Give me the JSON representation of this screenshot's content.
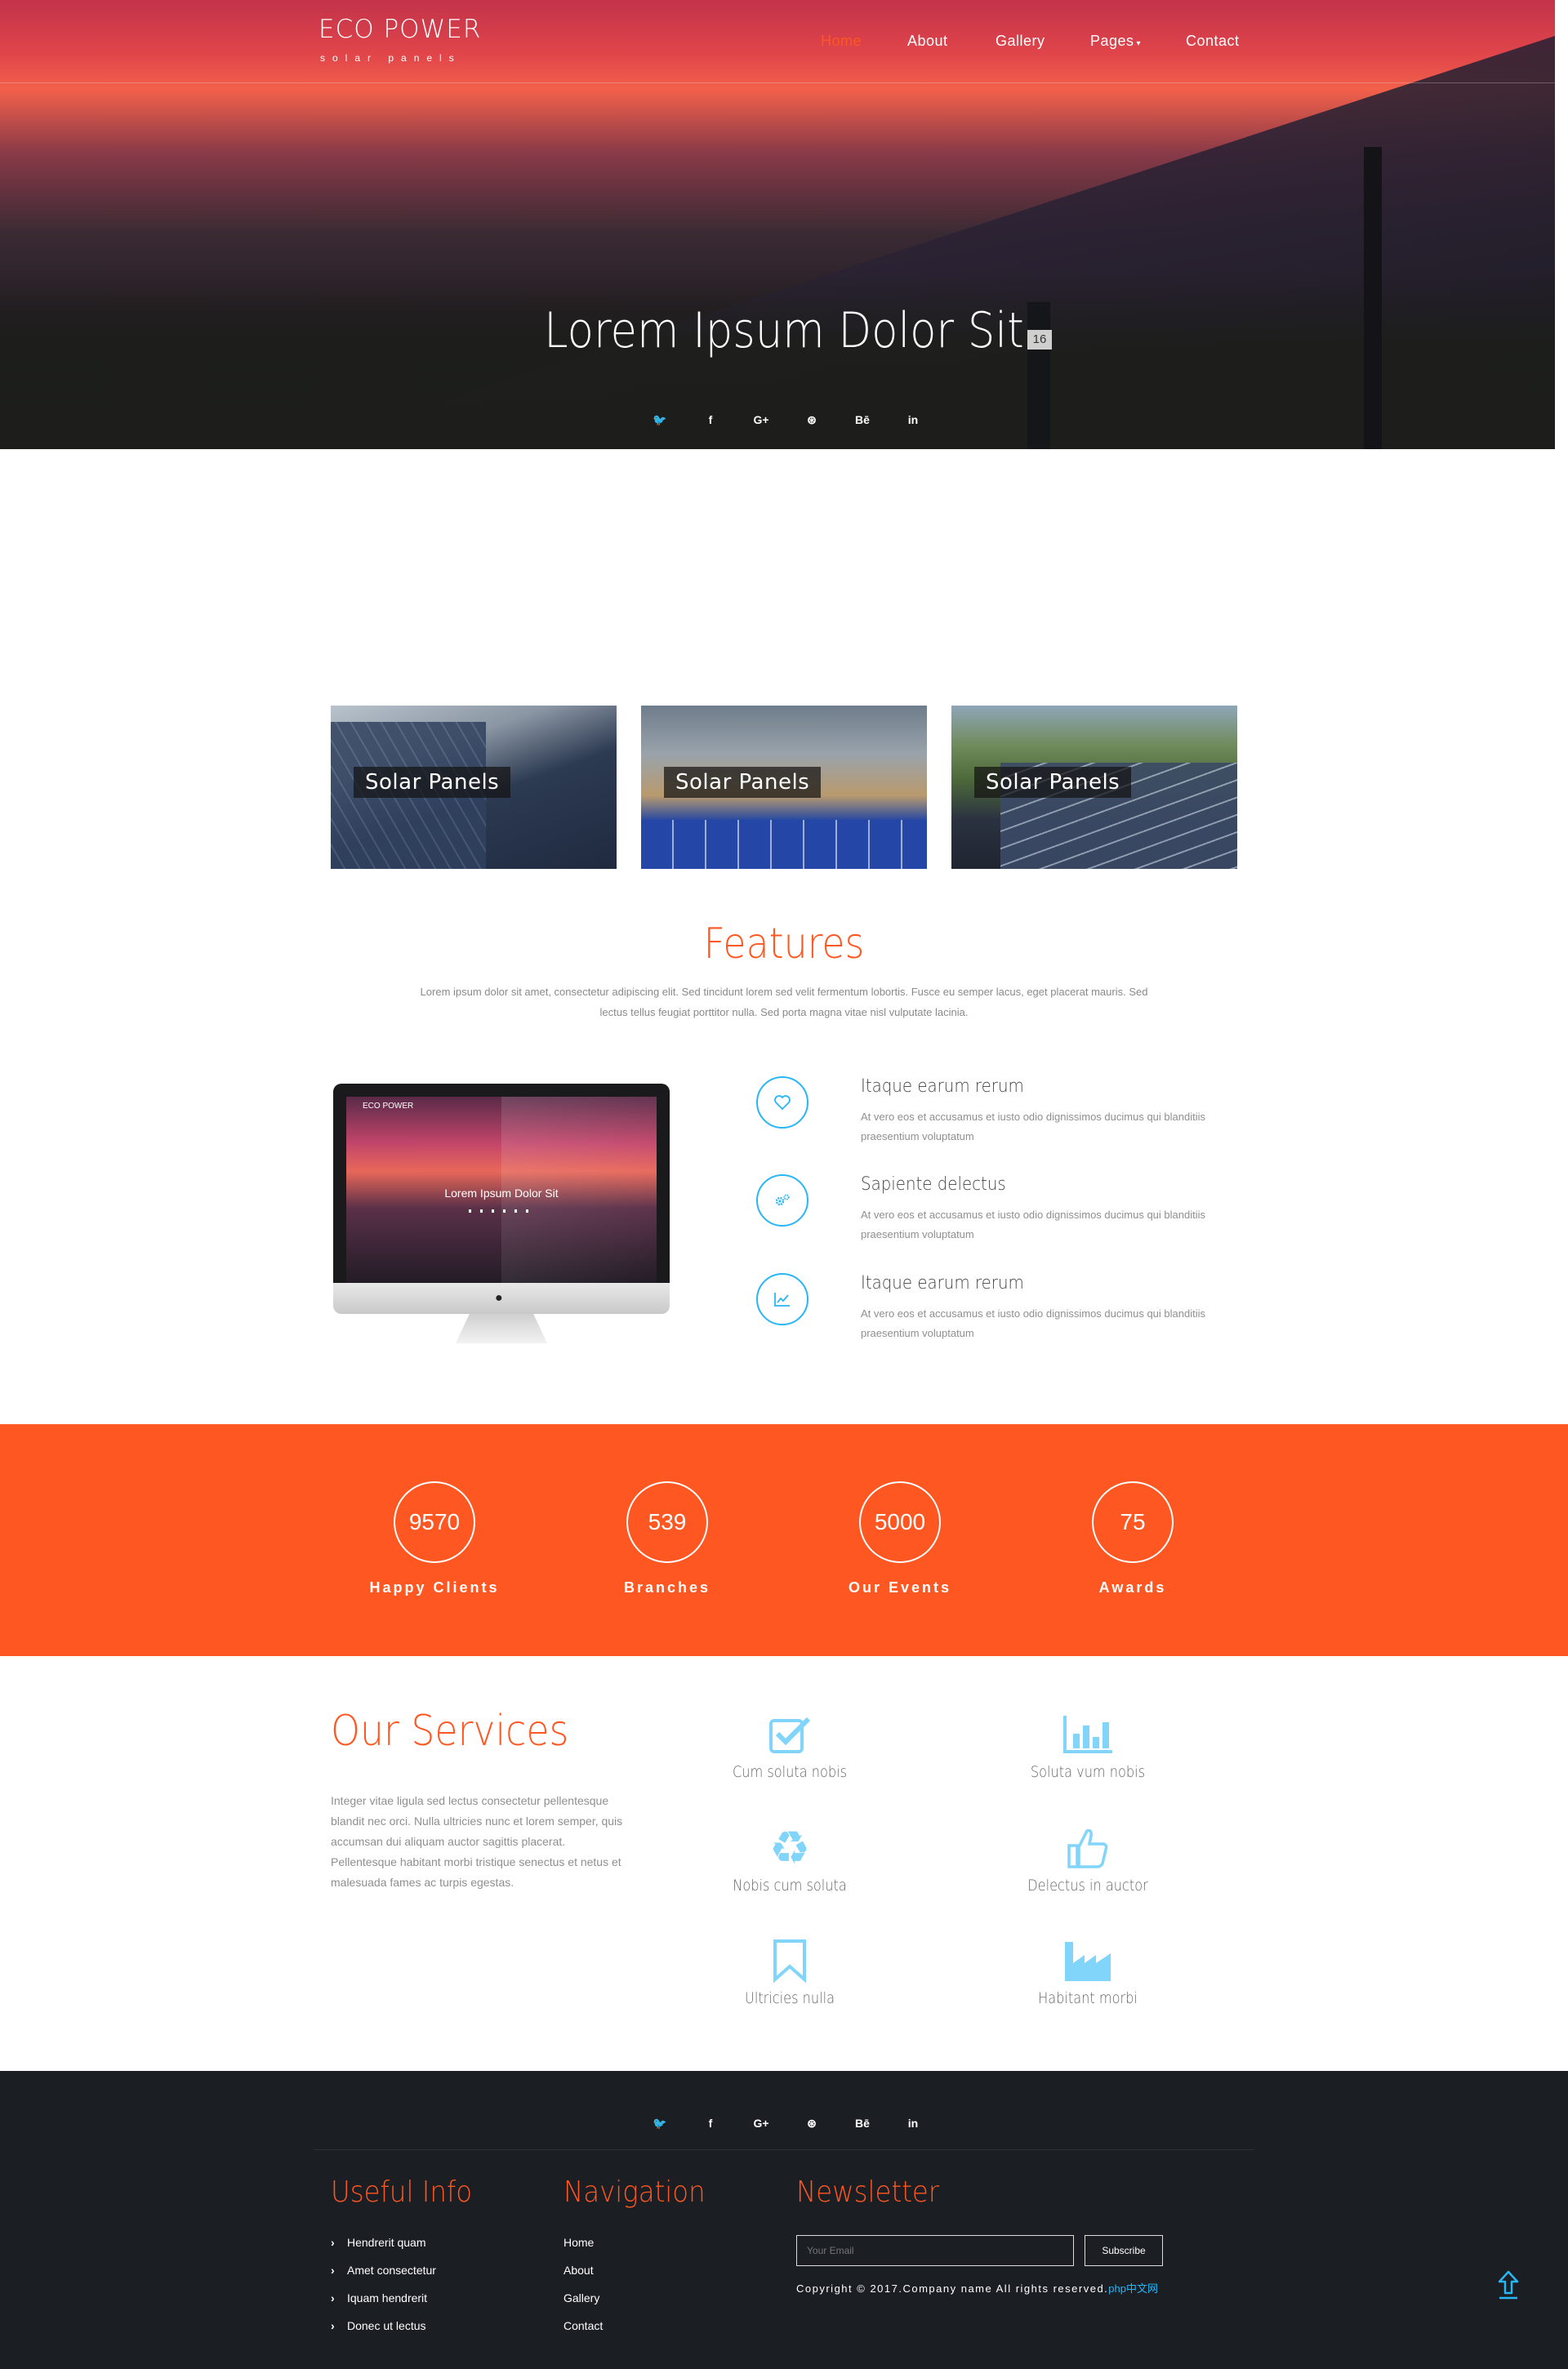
{
  "brand": {
    "name": "ECO POWER",
    "tagline": "solar panels"
  },
  "nav": {
    "items": [
      "Home",
      "About",
      "Gallery",
      "Pages",
      "Contact"
    ],
    "active": "Home"
  },
  "hero": {
    "title": "Lorem Ipsum Dolor Sit",
    "plate_number": "16"
  },
  "social": [
    "twitter-icon",
    "facebook-icon",
    "google-plus-icon",
    "dribbble-icon",
    "behance-icon",
    "linkedin-icon"
  ],
  "social_glyphs": {
    "twitter": "🐦",
    "facebook": "f",
    "googleplus": "G+",
    "dribbble": "⊛",
    "behance": "Bē",
    "linkedin": "in"
  },
  "gallery": [
    {
      "caption": "Solar Panels"
    },
    {
      "caption": "Solar Panels"
    },
    {
      "caption": "Solar Panels"
    }
  ],
  "features": {
    "title": "Features",
    "description": "Lorem ipsum dolor sit amet, consectetur adipiscing elit. Sed tincidunt lorem sed velit fermentum lobortis. Fusce eu semper lacus, eget placerat mauris. Sed lectus tellus feugiat porttitor nulla. Sed porta magna vitae nisl vulputate lacinia.",
    "monitor": {
      "logo": "ECO POWER",
      "title": "Lorem Ipsum Dolor Sit"
    },
    "items": [
      {
        "icon": "heart-icon",
        "title": "Itaque earum rerum",
        "text": "At vero eos et accusamus et iusto odio dignissimos ducimus qui blanditiis praesentium voluptatum"
      },
      {
        "icon": "gears-icon",
        "title": "Sapiente delectus",
        "text": "At vero eos et accusamus et iusto odio dignissimos ducimus qui blanditiis praesentium voluptatum"
      },
      {
        "icon": "line-chart-icon",
        "title": "Itaque earum rerum",
        "text": "At vero eos et accusamus et iusto odio dignissimos ducimus qui blanditiis praesentium voluptatum"
      }
    ]
  },
  "stats": [
    {
      "value": "9570",
      "label": "Happy Clients"
    },
    {
      "value": "539",
      "label": "Branches"
    },
    {
      "value": "5000",
      "label": "Our Events"
    },
    {
      "value": "75",
      "label": "Awards"
    }
  ],
  "services": {
    "title": "Our Services",
    "description": "Integer vitae ligula sed lectus consectetur pellentesque blandit nec orci. Nulla ultricies nunc et lorem semper, quis accumsan dui aliquam auctor sagittis placerat. Pellentesque habitant morbi tristique senectus et netus et malesuada fames ac turpis egestas.",
    "items": [
      {
        "icon": "check-square-icon",
        "label": "Cum soluta nobis"
      },
      {
        "icon": "bar-chart-icon",
        "label": "Soluta vum nobis"
      },
      {
        "icon": "recycle-icon",
        "label": "Nobis cum soluta"
      },
      {
        "icon": "thumbs-up-icon",
        "label": "Delectus in auctor"
      },
      {
        "icon": "bookmark-icon",
        "label": "Ultricies nulla"
      },
      {
        "icon": "industry-icon",
        "label": "Habitant morbi"
      }
    ]
  },
  "footer": {
    "useful_info": {
      "title": "Useful Info",
      "links": [
        "Hendrerit quam",
        "Amet consectetur",
        "Iquam hendrerit",
        "Donec ut lectus"
      ]
    },
    "navigation": {
      "title": "Navigation",
      "links": [
        "Home",
        "About",
        "Gallery",
        "Contact"
      ]
    },
    "newsletter": {
      "title": "Newsletter",
      "placeholder": "Your Email",
      "button": "Subscribe"
    },
    "copyright": "Copyright © 2017.Company name All rights reserved.",
    "copyright_link": "php中文网"
  },
  "colors": {
    "accent": "#ff5722",
    "icon_blue": "#29b6f6",
    "footer_bg": "#1b1e23"
  }
}
